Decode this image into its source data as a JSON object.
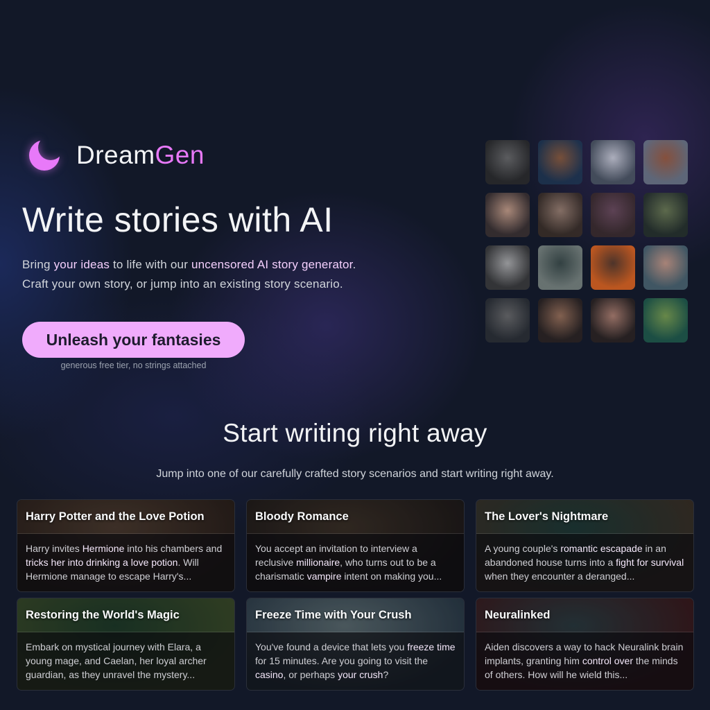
{
  "brand": {
    "icon": "crescent-moon-icon",
    "name_part1": "Dream",
    "name_part2": "Gen",
    "accent_color": "#e879f9"
  },
  "hero": {
    "title": "Write stories with AI",
    "subtitle_line1": [
      {
        "text": "Bring ",
        "highlight": false
      },
      {
        "text": "your ideas",
        "highlight": true
      },
      {
        "text": " to life with our ",
        "highlight": false
      },
      {
        "text": "uncensored AI story generator",
        "highlight": true
      },
      {
        "text": ".",
        "highlight": false
      }
    ],
    "subtitle_line2": "Craft your own story, or jump into an existing story scenario.",
    "cta_label": "Unleash your fantasies",
    "cta_color": "#f0abfc",
    "cta_note": "generous free tier, no strings attached"
  },
  "gallery": {
    "thumbnails": [
      {
        "name": "dark-portrait-man-thinking",
        "colors": [
          "#2a2a2a",
          "#6b6b6b"
        ]
      },
      {
        "name": "pirate-warrior",
        "colors": [
          "#1d3550",
          "#8a5a3a"
        ]
      },
      {
        "name": "white-haired-fox-girl",
        "colors": [
          "#4a5560",
          "#c9cdd6"
        ]
      },
      {
        "name": "barbarian-woman",
        "colors": [
          "#6a7684",
          "#9a5a3a"
        ]
      },
      {
        "name": "three-witches",
        "colors": [
          "#3a3030",
          "#c9a08a"
        ]
      },
      {
        "name": "man-in-robe",
        "colors": [
          "#3a2e26",
          "#9b8070"
        ]
      },
      {
        "name": "vampire-at-desk",
        "colors": [
          "#3a2a2a",
          "#6a4a5a"
        ]
      },
      {
        "name": "fantasy-mountain-landscape",
        "colors": [
          "#243028",
          "#6a7a50"
        ]
      },
      {
        "name": "horned-white-hair-demon",
        "colors": [
          "#3a3a3a",
          "#b0b0b0"
        ]
      },
      {
        "name": "city-street-car",
        "colors": [
          "#7a8580",
          "#3a4a48"
        ]
      },
      {
        "name": "orange-hair-anime-girl",
        "colors": [
          "#e0641e",
          "#5a3a2a"
        ]
      },
      {
        "name": "woman-with-choker",
        "colors": [
          "#4a6470",
          "#c89a88"
        ]
      },
      {
        "name": "white-haired-warrior",
        "colors": [
          "#2a2e33",
          "#6a6a6a"
        ]
      },
      {
        "name": "bearded-man-portrait",
        "colors": [
          "#2a2220",
          "#9a7058"
        ]
      },
      {
        "name": "brunette-woman-portrait",
        "colors": [
          "#2a2220",
          "#b08070"
        ]
      },
      {
        "name": "forest-dryad",
        "colors": [
          "#1e5a4a",
          "#7aa050"
        ]
      }
    ]
  },
  "section": {
    "title": "Start writing right away",
    "subtitle": "Jump into one of our carefully crafted story scenarios and start writing right away."
  },
  "scenarios": [
    {
      "title": "Harry Potter and the Love Potion",
      "bg": [
        "#4a3a30",
        "#2a201c"
      ],
      "description": [
        {
          "text": "Harry invites ",
          "highlight": false
        },
        {
          "text": "Hermione",
          "highlight": true
        },
        {
          "text": " into his chambers and ",
          "highlight": false
        },
        {
          "text": "tricks her into drinking a love potion",
          "highlight": true
        },
        {
          "text": ". Will Hermione manage to escape Harry's...",
          "highlight": false
        }
      ]
    },
    {
      "title": "Bloody Romance",
      "bg": [
        "#3a3028",
        "#1e1a1a"
      ],
      "description": [
        {
          "text": "You accept an invitation to interview a reclusive ",
          "highlight": false
        },
        {
          "text": "millionaire",
          "highlight": true
        },
        {
          "text": ", who turns out to be a charismatic ",
          "highlight": false
        },
        {
          "text": "vampire",
          "highlight": true
        },
        {
          "text": " intent on making you...",
          "highlight": false
        }
      ]
    },
    {
      "title": "The Lover's Nightmare",
      "bg": [
        "#1e3a38",
        "#3a3028"
      ],
      "description": [
        {
          "text": "A young couple's ",
          "highlight": false
        },
        {
          "text": "romantic escapade",
          "highlight": true
        },
        {
          "text": " in an abandoned house turns into a ",
          "highlight": false
        },
        {
          "text": "fight for survival",
          "highlight": true
        },
        {
          "text": " when they encounter a deranged...",
          "highlight": false
        }
      ]
    },
    {
      "title": "Restoring the World's Magic",
      "bg": [
        "#1e3a2a",
        "#3a4a2a"
      ],
      "description": [
        {
          "text": "Embark on mystical journey with Elara, a young mage, and Caelan, her loyal archer guardian, as they unravel the mystery...",
          "highlight": false
        }
      ]
    },
    {
      "title": "Freeze Time with Your Crush",
      "bg": [
        "#5a6a70",
        "#2a3a48"
      ],
      "description": [
        {
          "text": "You've found a device that lets you ",
          "highlight": false
        },
        {
          "text": "freeze time",
          "highlight": true
        },
        {
          "text": " for 15 minutes. Are you going to visit the ",
          "highlight": false
        },
        {
          "text": "casino",
          "highlight": true
        },
        {
          "text": ", or perhaps ",
          "highlight": false
        },
        {
          "text": "your crush",
          "highlight": true
        },
        {
          "text": "?",
          "highlight": false
        }
      ]
    },
    {
      "title": "Neuralinked",
      "bg": [
        "#2a3a40",
        "#3a1a1e"
      ],
      "description": [
        {
          "text": "Aiden discovers a way to hack Neuralink brain implants, granting him ",
          "highlight": false
        },
        {
          "text": "control over",
          "highlight": true
        },
        {
          "text": " the minds of others. How will he wield this...",
          "highlight": false
        }
      ]
    }
  ]
}
